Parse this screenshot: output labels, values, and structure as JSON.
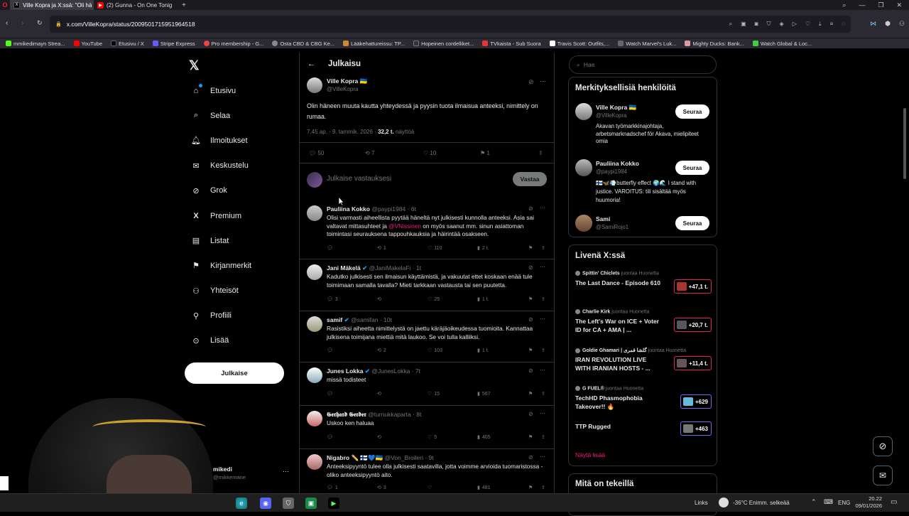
{
  "browser": {
    "tabs": [
      {
        "label": "Ville Kopra ja X:ssä: \"Oli hä",
        "active": true
      },
      {
        "label": "(2) Gunna - On One Tonig",
        "active": false
      }
    ],
    "url": "x.com/VilleKopra/status/2009501715951964518",
    "bookmarks": [
      "mmikedimayn Strea...",
      "YouTube",
      "Etusivu / X",
      "Stripe Express",
      "Pro membership - G...",
      "Osta CBD & CBG Ke...",
      "Lääkehattureissu: TP...",
      "Hopeinen cordelliket...",
      "TVkaista - Sub Suora",
      "Travis Scott: Outfits,...",
      "Watch Marvel's Luk...",
      "Mighty Ducks: Bank...",
      "Watch Global & Loc..."
    ]
  },
  "nav": {
    "items": [
      {
        "label": "Etusivu",
        "icon": "home-icon"
      },
      {
        "label": "Selaa",
        "icon": "search-icon"
      },
      {
        "label": "Ilmoitukset",
        "icon": "bell-icon"
      },
      {
        "label": "Keskustelu",
        "icon": "mail-icon"
      },
      {
        "label": "Grok",
        "icon": "grok-icon"
      },
      {
        "label": "Premium",
        "icon": "x-icon"
      },
      {
        "label": "Listat",
        "icon": "list-icon"
      },
      {
        "label": "Kirjanmerkit",
        "icon": "bookmark-icon"
      },
      {
        "label": "Yhteisöt",
        "icon": "people-icon"
      },
      {
        "label": "Profiili",
        "icon": "person-icon"
      },
      {
        "label": "Lisää",
        "icon": "more-icon"
      }
    ],
    "post_label": "Julkaise",
    "account_name": "mikedi",
    "account_handle": "@mikkemane"
  },
  "header": {
    "title": "Julkaisu"
  },
  "post": {
    "name": "Ville Kopra",
    "flag": "🇺🇦",
    "handle": "@VilleKopra",
    "text": "Olin häneen muuta kautta yhteydessä ja pyysin tuota ilmaisua anteeksi, nimittely on rumaa.",
    "time": "7.45 ap. · 9. tammik. 2026 ·",
    "views": "32,2 t.",
    "views_label": "näyttöä",
    "replies": "50",
    "reposts": "7",
    "likes": "10",
    "bookmarks": "1"
  },
  "composer": {
    "placeholder": "Julkaise vastauksesi",
    "button": "Vastaa"
  },
  "replies": [
    {
      "name": "Pauliina Kokko",
      "handle": "@paypi1984 · 6t",
      "verified": false,
      "text_before": "Olisi varmasti aiheellista pyytää häneltä nyt julkisesti kunnolla anteeksi. Asia sai valtavat mittasuhteet ja ",
      "mention": "@VNissinen",
      "text_after": " on myös saanut mm. sinun asiattoman toimintasi seurauksena tappouhkauksia ja häirintää osakseen.",
      "replies": "",
      "reposts": "1",
      "likes": "110",
      "views": "2 t."
    },
    {
      "name": "Jani Mäkelä",
      "handle": "@JaniMakelaFi · 1t",
      "verified": true,
      "text_before": "Kadutko julkisesti sen ilmaisun käyttämistä, ja vakuutat ettet koskaan enää tule toimimaan samalla tavalla? Mieti tarkkaan vastausta tai sen puutetta.",
      "mention": "",
      "text_after": "",
      "replies": "3",
      "reposts": "",
      "likes": "29",
      "views": "1 t."
    },
    {
      "name": "samif",
      "handle": "@samifan · 10t",
      "verified": true,
      "text_before": "Rasistiksi aiheetta nimittelystä on jaettu käräjäoikeudessa tuomioita. Kannattaa julkisena toimijana miettiä mitä laukoo. Se voi tulla kalliiksi.",
      "mention": "",
      "text_after": "",
      "replies": "",
      "reposts": "2",
      "likes": "103",
      "views": "1 t."
    },
    {
      "name": "Junes Lokka",
      "handle": "@JunesLokka · 7t",
      "verified": true,
      "text_before": "missä todisteet",
      "mention": "",
      "text_after": "",
      "replies": "",
      "reposts": "",
      "likes": "15",
      "views": "567"
    },
    {
      "name": "𝕲𝖊𝖗𝖍𝖆𝖗𝖉 𝕲𝖊𝖗𝖉𝖊𝖗",
      "handle": "@turnukkaparta · 8t",
      "verified": false,
      "text_before": "Uskoo ken haluaa",
      "mention": "",
      "text_after": "",
      "replies": "",
      "reposts": "",
      "likes": "5",
      "views": "405"
    },
    {
      "name": "Nigabro ✏️ 🇫🇮💙🇺🇦",
      "handle": "@Von_Broileri · 9t",
      "verified": false,
      "text_before": "Anteeksipyyntö tulee olla julkisesti saatavilla, jotta voimme arvioida tuomaristossa - oliko anteeksipyyntö aito.",
      "mention": "",
      "text_after": "",
      "replies": "1",
      "reposts": "3",
      "likes": "",
      "views": "481"
    }
  ],
  "sidebar": {
    "search_placeholder": "Hae",
    "relevant_title": "Merkityksellisiä henkilöitä",
    "people": [
      {
        "name": "Ville Kopra 🇺🇦",
        "handle": "@VilleKopra",
        "bio": "Akavan työmarkkinajohtaja, arbetsmarknadschef för Akava, mielipiteet omia",
        "follow": "Seuraa"
      },
      {
        "name": "Pauliina Kokko",
        "handle": "@paypi1984",
        "bio": "🇫🇮🦋💨butterfly effect 🌍🌊 I stand with justice. VAROITUS: tili sisältää myös huumoria!",
        "follow": "Seuraa"
      },
      {
        "name": "Sami",
        "handle": "@SamiRojo1",
        "bio": "",
        "follow": "Seuraa"
      }
    ],
    "live_title": "Livenä X:ssä",
    "live": [
      {
        "host": "Spittin' Chiclets",
        "host_suffix": "juontaa Huonetta",
        "title": "The Last Dance - Episode 610",
        "count": "+47,1 t."
      },
      {
        "host": "Charlie Kirk",
        "host_suffix": "juontaa Huonetta",
        "title": "The Left's War on ICE + Voter ID for CA + AMA | ...",
        "count": "+20,7 t."
      },
      {
        "host": "Goldie Ghamari | گلشا قمری",
        "host_suffix": "juontaa Huonetta",
        "title": "IRAN REVOLUTION LIVE WITH IRANIAN HOSTS - ...",
        "count": "+11,4 t."
      },
      {
        "host": "G FUEL®",
        "host_suffix": "juontaa Huonetta",
        "title": "TechHD Phasmophobia Takeover!! 🔥",
        "count": "+629"
      },
      {
        "host": "",
        "host_suffix": "",
        "title": "TTP Rugged",
        "count": "+463"
      }
    ],
    "show_more": "Näytä lisää",
    "happening_title": "Mitä on tekeillä"
  },
  "taskbar": {
    "links": "Links",
    "weather": "-36°C  Enimm. selkeää",
    "lang": "ENG",
    "time": "20.22",
    "date": "09/01/2026"
  },
  "colors": {
    "accent": "#1d9bf0",
    "live": "#e0245e",
    "mention": "#f91880"
  }
}
